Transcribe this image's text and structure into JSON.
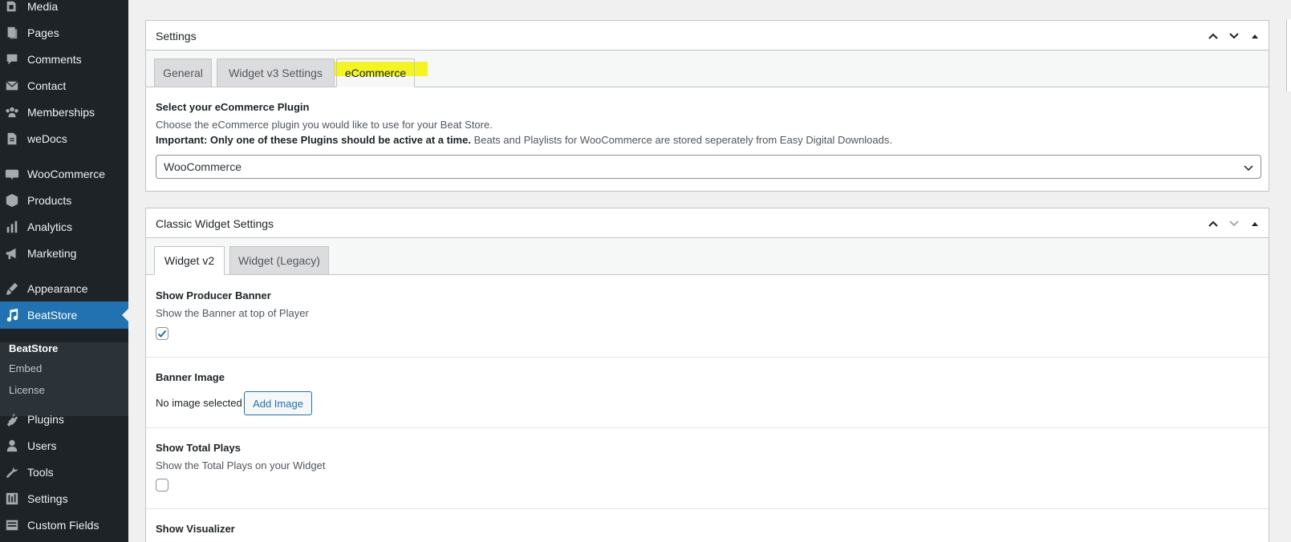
{
  "sidebar": {
    "items": [
      {
        "label": "Media",
        "icon": "media-icon"
      },
      {
        "label": "Pages",
        "icon": "pages-icon"
      },
      {
        "label": "Comments",
        "icon": "comments-icon"
      },
      {
        "label": "Contact",
        "icon": "mail-icon"
      },
      {
        "label": "Memberships",
        "icon": "groups-icon"
      },
      {
        "label": "weDocs",
        "icon": "document-icon"
      },
      {
        "label": "WooCommerce",
        "icon": "woo-icon"
      },
      {
        "label": "Products",
        "icon": "box-icon"
      },
      {
        "label": "Analytics",
        "icon": "bar-chart-icon"
      },
      {
        "label": "Marketing",
        "icon": "megaphone-icon"
      },
      {
        "label": "Appearance",
        "icon": "paintbrush-icon"
      },
      {
        "label": "BeatStore",
        "icon": "music-note-icon",
        "active": true
      },
      {
        "label": "Plugins",
        "icon": "plugin-icon"
      },
      {
        "label": "Users",
        "icon": "user-icon"
      },
      {
        "label": "Tools",
        "icon": "wrench-icon"
      },
      {
        "label": "Settings",
        "icon": "settings-icon"
      },
      {
        "label": "Custom Fields",
        "icon": "fields-icon"
      }
    ],
    "submenu": [
      "BeatStore",
      "Embed",
      "License"
    ]
  },
  "settings_box": {
    "title": "Settings",
    "tabs": [
      "General",
      "Widget v3 Settings",
      "eCommerce"
    ],
    "active_tab": "eCommerce",
    "field_label": "Select your eCommerce Plugin",
    "desc_line1": "Choose the eCommerce plugin you would like to use for your Beat Store.",
    "desc_bold": "Important: Only one of these Plugins should be active at a time.",
    "desc_rest": " Beats and Playlists for WooCommerce are stored seperately from Easy Digital Downloads.",
    "select_value": "WooCommerce"
  },
  "classic_box": {
    "title": "Classic Widget Settings",
    "tabs": [
      "Widget v2",
      "Widget (Legacy)"
    ],
    "active_tab": "Widget v2",
    "show_banner_label": "Show Producer Banner",
    "show_banner_desc": "Show the Banner at top of Player",
    "show_banner_checked": true,
    "banner_image_label": "Banner Image",
    "banner_image_status": "No image selected",
    "add_image_button": "Add Image",
    "total_plays_label": "Show Total Plays",
    "total_plays_desc": "Show the Total Plays on your Widget",
    "total_plays_checked": false,
    "visualizer_label": "Show Visualizer"
  },
  "colors": {
    "sidebar_bg": "#1d2327",
    "active_blue": "#2271b1",
    "highlight_yellow": "#f3f300"
  }
}
